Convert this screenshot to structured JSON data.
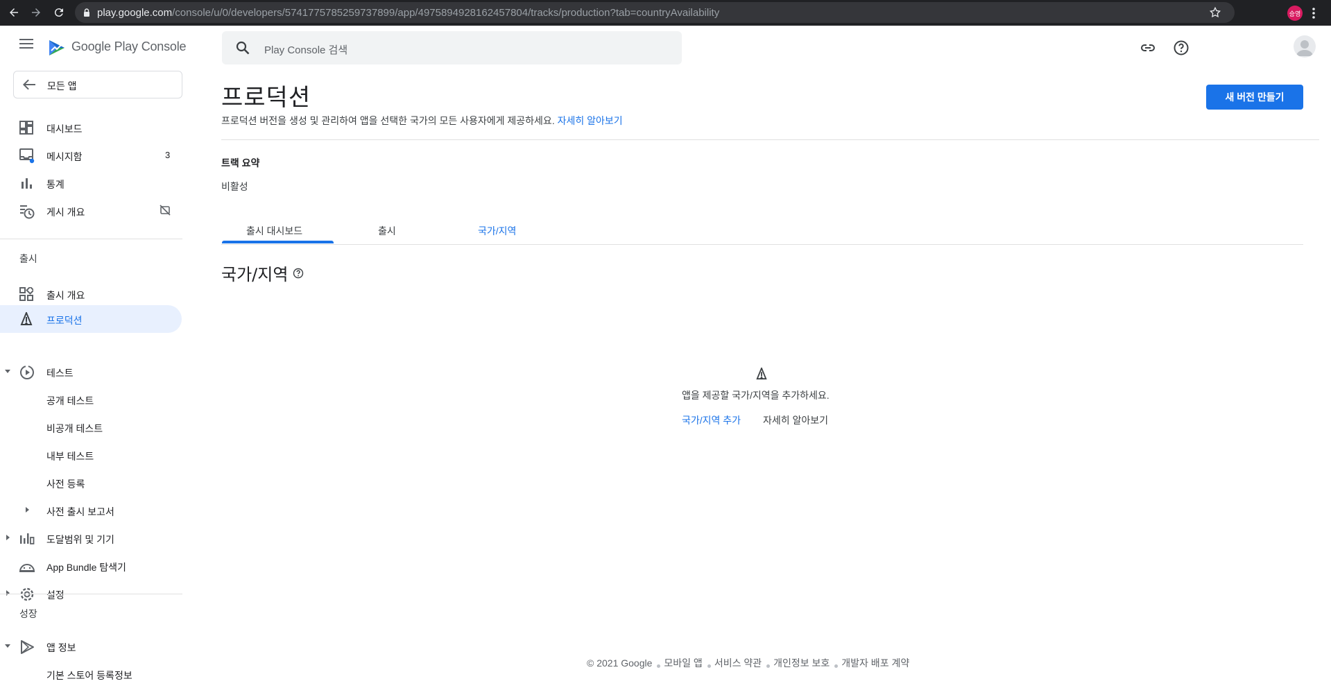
{
  "browser": {
    "url_host": "play.google.com",
    "url_path": "/console/u/0/developers/5741775785259737899/app/4975894928162457804/tracks/production?tab=countryAvailability",
    "profile_initials": "승영"
  },
  "sidebar": {
    "brand_google_play": "Google Play",
    "brand_console": "Console",
    "back_label": "모든 앱",
    "items_top": [
      {
        "label": "대시보드",
        "icon": "dashboard-icon"
      },
      {
        "label": "메시지함",
        "icon": "inbox-icon",
        "count": "3"
      },
      {
        "label": "통계",
        "icon": "bar-chart-icon"
      },
      {
        "label": "게시 개요",
        "icon": "history-icon",
        "right_icon": "publishing-off-icon"
      }
    ],
    "section_release": "출시",
    "items_release": [
      {
        "label": "출시 개요",
        "icon": "release-overview-icon"
      },
      {
        "label": "프로덕션",
        "icon": "production-icon",
        "active": true
      },
      {
        "label": "테스트",
        "icon": "testing-icon",
        "expanded": true
      },
      {
        "label": "공개 테스트"
      },
      {
        "label": "비공개 테스트"
      },
      {
        "label": "내부 테스트"
      },
      {
        "label": "사전 등록"
      },
      {
        "label": "사전 출시 보고서"
      },
      {
        "label": "도달범위 및 기기",
        "icon": "reach-devices-icon"
      },
      {
        "label": "App Bundle 탐색기",
        "icon": "app-bundle-icon"
      },
      {
        "label": "설정",
        "icon": "settings-gear-icon"
      }
    ],
    "section_growth": "성장",
    "items_growth": [
      {
        "label": "앱 정보",
        "icon": "play-store-icon"
      },
      {
        "label": "기본 스토어 등록정보"
      }
    ]
  },
  "search": {
    "placeholder": "Play Console 검색"
  },
  "header": {
    "title": "프로덕션",
    "description": "프로덕션 버전을 생성 및 관리하여 앱을 선택한 국가의 모든 사용자에게 제공하세요.",
    "learn_more": "자세히 알아보기",
    "create_button": "새 버전 만들기"
  },
  "track_summary": {
    "title": "트랙 요약",
    "value": "비활성"
  },
  "tabs": [
    {
      "label": "출시 대시보드"
    },
    {
      "label": "출시"
    },
    {
      "label": "국가/지역",
      "active": true
    }
  ],
  "country_section": {
    "heading": "국가/지역",
    "empty_message": "앱을 제공할 국가/지역을 추가하세요.",
    "add_link": "국가/지역 추가",
    "learn_more": "자세히 알아보기"
  },
  "footer": {
    "copyright": "© 2021 Google",
    "links": [
      "모바일 앱",
      "서비스 약관",
      "개인정보 보호",
      "개발자 배포 계약"
    ]
  },
  "colors": {
    "accent": "#1a73e8",
    "active_nav_bg": "#e8f0fe",
    "chrome_bg": "#202124"
  }
}
